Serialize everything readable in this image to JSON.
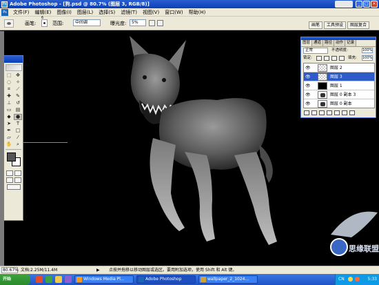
{
  "window": {
    "title": "Adobe Photoshop - [狗.psd @ 80.7% (图层 3, RGB/8)]",
    "app_icon": "photoshop-icon"
  },
  "menu": [
    "文件(F)",
    "编辑(E)",
    "图像(I)",
    "图层(L)",
    "选择(S)",
    "滤镜(T)",
    "视图(V)",
    "窗口(W)",
    "帮助(H)"
  ],
  "options": {
    "brush_label": "画笔:",
    "brush_size": "6",
    "range_label": "范围:",
    "range_value": "中间调",
    "exposure_label": "曝光度:",
    "exposure_value": "5%"
  },
  "palette_well": [
    "画笔",
    "工具预设",
    "图层复合"
  ],
  "layers_panel": {
    "tabs": [
      "图层",
      "通道",
      "路径",
      "动作",
      "记录"
    ],
    "blend_mode": "正常",
    "opacity_label": "不透明度:",
    "opacity_value": "100%",
    "lock_label": "锁定:",
    "fill_label": "填充:",
    "fill_value": "100%",
    "layers": [
      {
        "name": "图层 2",
        "visible": true,
        "selected": false,
        "thumb": "checker"
      },
      {
        "name": "图层 3",
        "visible": true,
        "selected": true,
        "thumb": "checker"
      },
      {
        "name": "图层 1",
        "visible": true,
        "selected": false,
        "thumb": "black"
      },
      {
        "name": "图层 0 副本 3",
        "visible": true,
        "selected": false,
        "thumb": "dog"
      },
      {
        "name": "图层 0 副本",
        "visible": true,
        "selected": false,
        "thumb": "dog"
      }
    ]
  },
  "status": {
    "zoom": "80.67%",
    "doc_info": "文档:2.25M/11.4M",
    "hint": "点按并拖移以移动图层或选区。要用附加选项，使用 Shift 和 Alt 键。"
  },
  "taskbar": {
    "start_label": "开始",
    "tasks": [
      {
        "label": "Windows Media Pl...",
        "active": false,
        "icon_color": "#f29b22"
      },
      {
        "label": "Adobe Photoshop",
        "active": true,
        "icon_color": "#1b66b6"
      },
      {
        "label": "wallpaper_2_1024...",
        "active": false,
        "icon_color": "#cfa23c"
      }
    ],
    "lang": "CN",
    "clock": "5:33"
  },
  "watermark": {
    "text": "思缘联盟"
  },
  "colors": {
    "xp_blue": "#0b3fb7",
    "panel_bg": "#ece9d8",
    "selection": "#2d5bc9",
    "canvas": "#000000"
  }
}
